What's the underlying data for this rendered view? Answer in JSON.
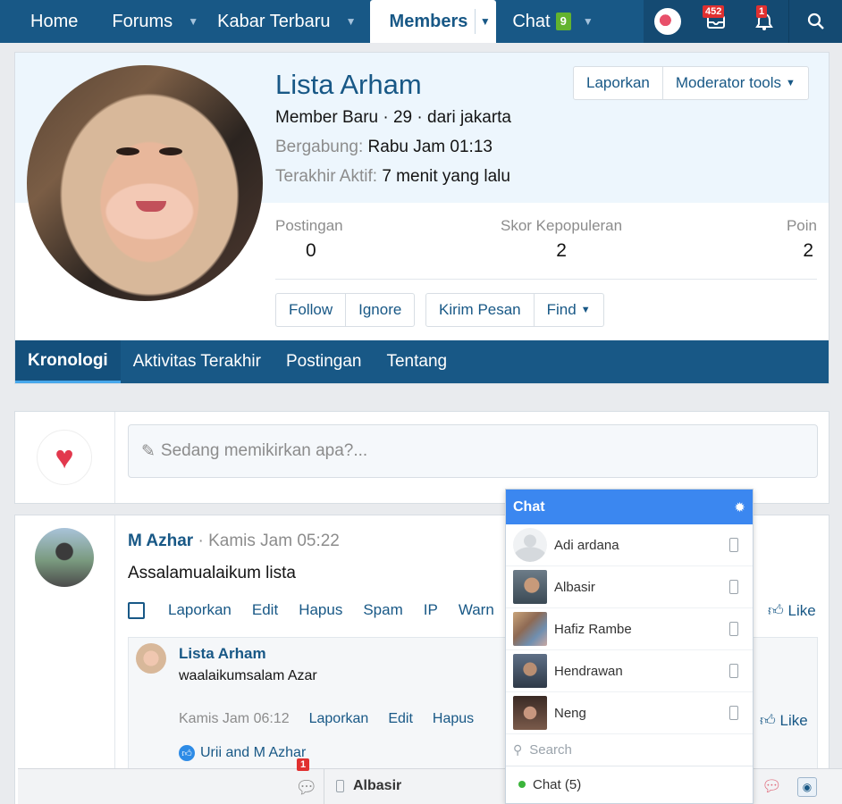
{
  "nav": {
    "tabs": [
      {
        "label": "Home"
      },
      {
        "label": "Forums"
      },
      {
        "label": "Kabar Terbaru"
      },
      {
        "label": "Members"
      },
      {
        "label": "Chat",
        "badge": "9"
      }
    ],
    "inbox_count": "452",
    "alerts_count": "1"
  },
  "profile": {
    "name": "Lista Arham",
    "blurb": "Member Baru · 29 · dari jakarta",
    "joined_label": "Bergabung:",
    "joined_value": "Rabu Jam 01:13",
    "last_active_label": "Terakhir Aktif:",
    "last_active_value": "7 menit yang lalu",
    "report_label": "Laporkan",
    "moderator_label": "Moderator tools",
    "stats": [
      {
        "label": "Postingan",
        "value": "0"
      },
      {
        "label": "Skor Kepopuleran",
        "value": "2"
      },
      {
        "label": "Poin",
        "value": "2"
      }
    ],
    "follow_label": "Follow",
    "ignore_label": "Ignore",
    "message_label": "Kirim Pesan",
    "find_label": "Find",
    "tabs": [
      {
        "label": "Kronologi",
        "active": true
      },
      {
        "label": "Aktivitas Terakhir"
      },
      {
        "label": "Postingan"
      },
      {
        "label": "Tentang"
      }
    ]
  },
  "poster": {
    "placeholder": "Sedang memikirkan apa?..."
  },
  "post": {
    "author": "M Azhar",
    "meta": "· Kamis Jam 05:22",
    "body": "Assalamualaikum lista",
    "actions": [
      "Laporkan",
      "Edit",
      "Hapus",
      "Spam",
      "IP",
      "Warn"
    ],
    "like_label": "Like",
    "reply": {
      "author": "Lista Arham",
      "body": "waalaikumsalam Azar",
      "time": "Kamis Jam 06:12",
      "actions": [
        "Laporkan",
        "Edit",
        "Hapus"
      ],
      "like_label": "Like",
      "reactions": "Urii and M Azhar"
    }
  },
  "chat": {
    "title": "Chat",
    "users": [
      {
        "name": "Adi ardana"
      },
      {
        "name": "Albasir"
      },
      {
        "name": "Hafiz Rambe"
      },
      {
        "name": "Hendrawan"
      },
      {
        "name": "Neng"
      }
    ],
    "search_placeholder": "Search",
    "online_label": "Chat (5)"
  },
  "bottombar": {
    "badge": "1",
    "contact": "Albasir"
  }
}
